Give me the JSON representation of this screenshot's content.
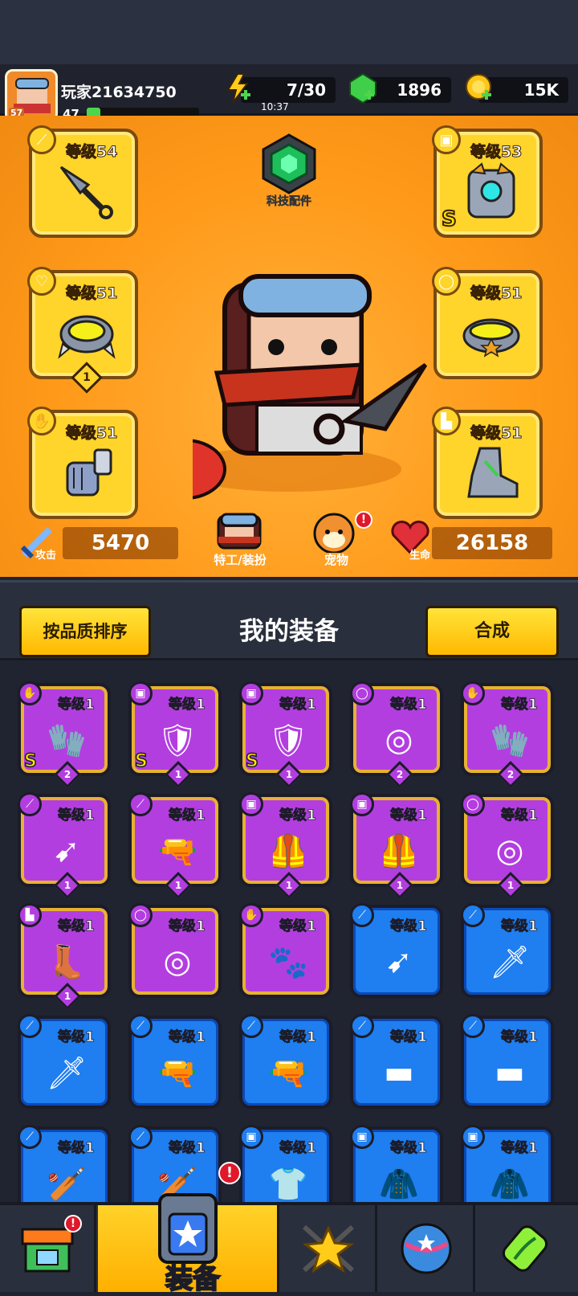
{
  "player": {
    "name": "玩家21634750",
    "level": "47",
    "avatar_level": "57",
    "xp_fraction": 0.12
  },
  "resources": {
    "energy": {
      "value": "7/30",
      "timer": "10:37",
      "icon": "lightning-icon"
    },
    "gems": {
      "value": "1896",
      "icon": "green-gem-icon"
    },
    "coins": {
      "value": "15K",
      "icon": "gold-coin-icon"
    }
  },
  "equipment_slots": [
    {
      "slot": "weapon",
      "level": "等级54",
      "icon": "kunai-icon"
    },
    {
      "slot": "armor",
      "level": "等级53",
      "icon": "armor-icon",
      "grade": "S"
    },
    {
      "slot": "necklace",
      "level": "等级51",
      "icon": "spiked-collar-icon",
      "count": "1"
    },
    {
      "slot": "belt",
      "level": "等级51",
      "icon": "belt-icon"
    },
    {
      "slot": "gloves",
      "level": "等级51",
      "icon": "gauntlet-icon"
    },
    {
      "slot": "boots",
      "level": "等级51",
      "icon": "boot-icon"
    }
  ],
  "tech_parts": {
    "label": "科技配件",
    "icon": "hex-chip-icon"
  },
  "stats": {
    "attack_label": "攻击",
    "attack": "5470",
    "hp_label": "生命",
    "hp": "26158"
  },
  "center_buttons": {
    "agent_label": "特工/装扮",
    "pet_label": "宠物"
  },
  "panel": {
    "sort_label": "按品质排序",
    "title": "我的装备",
    "merge_label": "合成"
  },
  "inventory": [
    {
      "rarity": "purple",
      "type": "gloves",
      "level": "等级1",
      "grade": "S",
      "count": "2",
      "icon": "gauntlet-icon"
    },
    {
      "rarity": "purple",
      "type": "armor",
      "level": "等级1",
      "grade": "S",
      "count": "1",
      "icon": "armor-icon"
    },
    {
      "rarity": "purple",
      "type": "armor",
      "level": "等级1",
      "grade": "S",
      "count": "1",
      "icon": "armor-icon"
    },
    {
      "rarity": "purple",
      "type": "belt",
      "level": "等级1",
      "count": "2",
      "icon": "belt-icon"
    },
    {
      "rarity": "purple",
      "type": "gloves",
      "level": "等级1",
      "count": "2",
      "icon": "gauntlet-icon"
    },
    {
      "rarity": "purple",
      "type": "weapon",
      "level": "等级1",
      "count": "1",
      "icon": "kunai-icon"
    },
    {
      "rarity": "purple",
      "type": "weapon",
      "level": "等级1",
      "count": "1",
      "icon": "revolver-icon"
    },
    {
      "rarity": "purple",
      "type": "armor",
      "level": "等级1",
      "count": "1",
      "icon": "vest-icon"
    },
    {
      "rarity": "purple",
      "type": "armor",
      "level": "等级1",
      "count": "1",
      "icon": "vest-icon"
    },
    {
      "rarity": "purple",
      "type": "belt",
      "level": "等级1",
      "count": "1",
      "icon": "belt-icon"
    },
    {
      "rarity": "purple",
      "type": "boots",
      "level": "等级1",
      "count": "1",
      "icon": "boot-icon"
    },
    {
      "rarity": "purple",
      "type": "belt",
      "level": "等级1",
      "icon": "belt-icon"
    },
    {
      "rarity": "purple",
      "type": "gloves",
      "level": "等级1",
      "icon": "claw-icon"
    },
    {
      "rarity": "blue",
      "type": "weapon",
      "level": "等级1",
      "icon": "kunai-icon"
    },
    {
      "rarity": "blue",
      "type": "weapon",
      "level": "等级1",
      "icon": "machete-icon"
    },
    {
      "rarity": "blue",
      "type": "weapon",
      "level": "等级1",
      "icon": "machete-icon"
    },
    {
      "rarity": "blue",
      "type": "weapon",
      "level": "等级1",
      "icon": "revolver-icon"
    },
    {
      "rarity": "blue",
      "type": "weapon",
      "level": "等级1",
      "icon": "revolver-icon"
    },
    {
      "rarity": "blue",
      "type": "weapon",
      "level": "等级1",
      "icon": "shotgun-icon"
    },
    {
      "rarity": "blue",
      "type": "weapon",
      "level": "等级1",
      "icon": "shotgun-icon"
    },
    {
      "rarity": "blue",
      "type": "weapon",
      "level": "等级1",
      "icon": "bat-icon"
    },
    {
      "rarity": "blue",
      "type": "weapon",
      "level": "等级1",
      "icon": "bat-icon"
    },
    {
      "rarity": "blue",
      "type": "armor",
      "level": "等级1",
      "icon": "shirt-icon"
    },
    {
      "rarity": "blue",
      "type": "armor",
      "level": "等级1",
      "icon": "jacket-icon"
    },
    {
      "rarity": "blue",
      "type": "armor",
      "level": "等级1",
      "icon": "jacket-icon"
    }
  ],
  "tabs": [
    {
      "name": "shop",
      "icon": "shop-icon",
      "alert": true
    },
    {
      "name": "equipment",
      "label": "装备",
      "icon": "equipment-icon",
      "alert": true,
      "active": true
    },
    {
      "name": "talents",
      "icon": "star-swords-icon"
    },
    {
      "name": "worlds",
      "icon": "planet-icon"
    },
    {
      "name": "evolve",
      "icon": "dna-capsule-icon"
    }
  ],
  "colors": {
    "arena": "#ff9a1a",
    "slot_gold": "#ffd42b",
    "purple": "#b33ee0",
    "blue": "#1f7ef0",
    "panel": "#2a2f3d",
    "button_yellow": "#ffc21a"
  }
}
